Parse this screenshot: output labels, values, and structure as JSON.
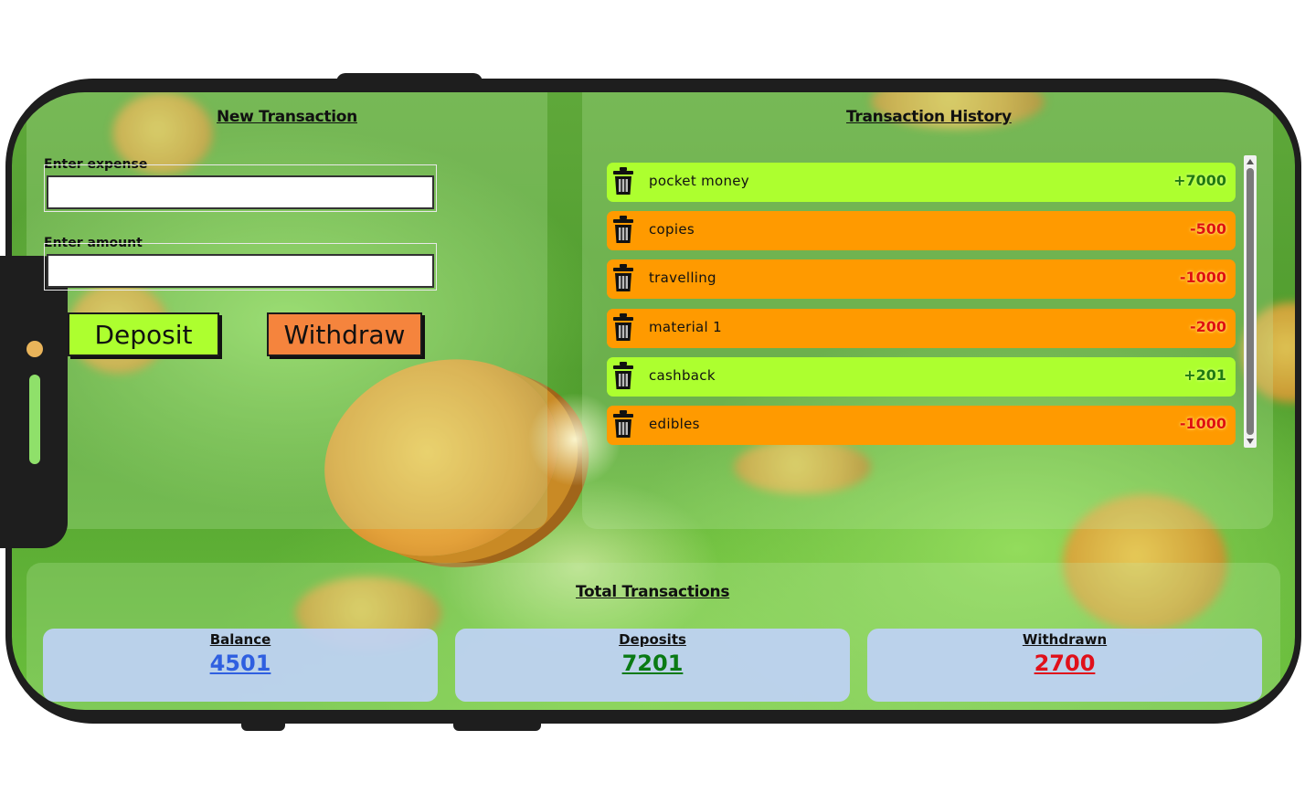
{
  "new_transaction": {
    "title": "New Transaction",
    "expense_label": "Enter expense",
    "expense_value": "",
    "amount_label": "Enter amount",
    "amount_value": "",
    "deposit_label": "Deposit",
    "withdraw_label": "Withdraw"
  },
  "history": {
    "title": "Transaction History",
    "items": [
      {
        "name": "pocket money",
        "amount": "+7000",
        "type": "deposit"
      },
      {
        "name": "copies",
        "amount": "-500",
        "type": "withdraw"
      },
      {
        "name": "travelling",
        "amount": "-1000",
        "type": "withdraw"
      },
      {
        "name": "material 1",
        "amount": "-200",
        "type": "withdraw"
      },
      {
        "name": "cashback",
        "amount": "+201",
        "type": "deposit"
      },
      {
        "name": "edibles",
        "amount": "-1000",
        "type": "withdraw"
      }
    ]
  },
  "totals": {
    "title": "Total Transactions",
    "balance_label": "Balance",
    "balance_value": "4501",
    "deposits_label": "Deposits",
    "deposits_value": "7201",
    "withdrawn_label": "Withdrawn",
    "withdrawn_value": "2700"
  },
  "colors": {
    "deposit_row": "#adff2f",
    "withdraw_row": "#ff9a00",
    "deposit_button": "#adff2f",
    "withdraw_button": "#f5843d",
    "balance_value": "#2f5fe0",
    "deposits_value": "#0a7a14",
    "withdrawn_value": "#e0101a"
  },
  "icons": {
    "delete": "trash-icon"
  }
}
